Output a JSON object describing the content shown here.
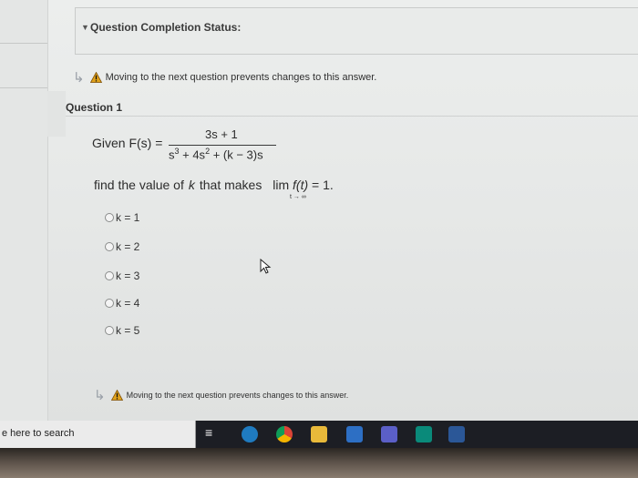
{
  "status": {
    "title": "Question Completion Status:"
  },
  "warning_text": "Moving to the next question prevents changes to this answer.",
  "question": {
    "label": "Question 1",
    "given_prefix": "Given F(s) =",
    "numerator": "3s + 1",
    "denominator_parts": [
      "s",
      "3",
      " + 4s",
      "2",
      " + (k − 3)s"
    ],
    "find_prefix": "find the value of",
    "find_var": "k",
    "find_mid": "that makes",
    "lim_word": "lim",
    "lim_fx": "f(t)",
    "lim_eq": "= 1.",
    "lim_sub": "t → ∞"
  },
  "options": [
    "k = 1",
    "k = 2",
    "k = 3",
    "k = 4",
    "k = 5"
  ],
  "taskbar": {
    "search_text": "e here to search",
    "icons": [
      "task-view-icon",
      "edge-icon",
      "chrome-icon",
      "file-explorer-icon",
      "mail-icon",
      "teams-icon",
      "app-icon",
      "word-icon"
    ]
  },
  "colors": {
    "warning": "#e0a21a",
    "taskbar": "#1c1e24"
  }
}
